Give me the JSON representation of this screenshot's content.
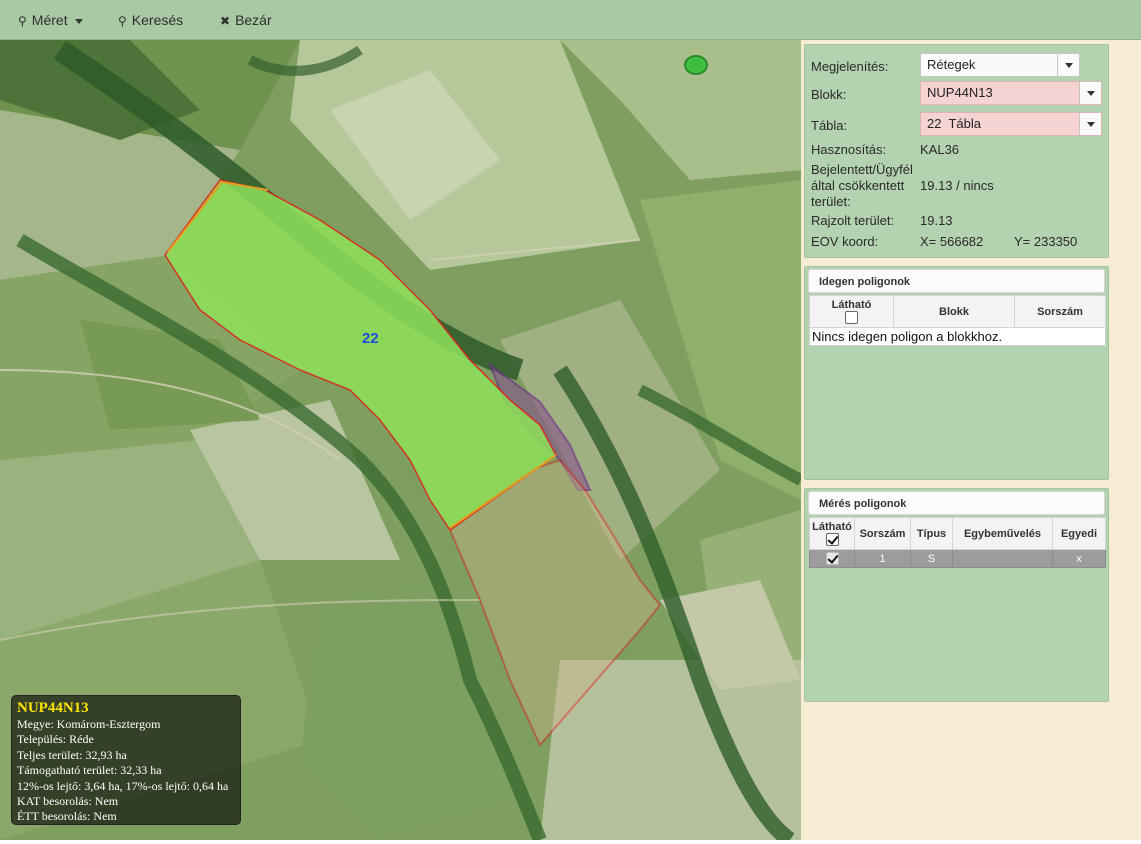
{
  "toolbar": {
    "meret_label": "Méret",
    "kereses_label": "Keresés",
    "bezar_label": "Bezár"
  },
  "map": {
    "parcel_label": "22",
    "info": {
      "title": "NUP44N13",
      "lines": [
        "Megye: Komárom-Esztergom",
        "Település: Réde",
        "Teljes terület: 32,93 ha",
        "Támogatható terület: 32,33 ha",
        "12%-os lejtő: 3,64 ha, 17%-os lejtő: 0,64 ha",
        "KAT besorolás: Nem",
        "ÉTT besorolás: Nem"
      ]
    }
  },
  "details": {
    "megjelenites_label": "Megjelenítés:",
    "megjelenites_value": "Rétegek",
    "blokk_label": "Blokk:",
    "blokk_value": "NUP44N13",
    "tabla_label": "Tábla:",
    "tabla_value": "22  Tábla",
    "hasznositas_label": "Hasznosítás:",
    "hasznositas_value": "KAL36",
    "bejelentett_label_1": "Bejelentett/Ügyfél",
    "bejelentett_label_2": "által csökkentett",
    "bejelentett_label_3": "terület:",
    "bejelentett_value": "19.13 / nincs",
    "rajzolt_label": "Rajzolt terület:",
    "rajzolt_value": "19.13",
    "eov_label": "EOV koord:",
    "eov_x": "X= 566682",
    "eov_y": "Y= 233350"
  },
  "idegen": {
    "title": "Idegen poligonok",
    "col_lathato": "Látható",
    "col_blokk": "Blokk",
    "col_sorszam": "Sorszám",
    "empty": "Nincs idegen poligon a blokkhoz."
  },
  "meres": {
    "title": "Mérés poligonok",
    "col_lathato": "Látható",
    "col_sorszam": "Sorszám",
    "col_tipus": "Típus",
    "col_egybe": "Egybeművelés",
    "col_egyedi": "Egyedi",
    "row": {
      "sorszam": "1",
      "tipus": "S",
      "egybe": "",
      "egyedi": "x"
    }
  },
  "colors": {
    "toolbar": "#a9c9a4",
    "panel": "#b3d2af",
    "parcel_fill": "#8fe05a",
    "boundary_red": "#e0201a",
    "boundary_purple": "#6a2a8a",
    "invalid_field": "#f5d3d3"
  }
}
